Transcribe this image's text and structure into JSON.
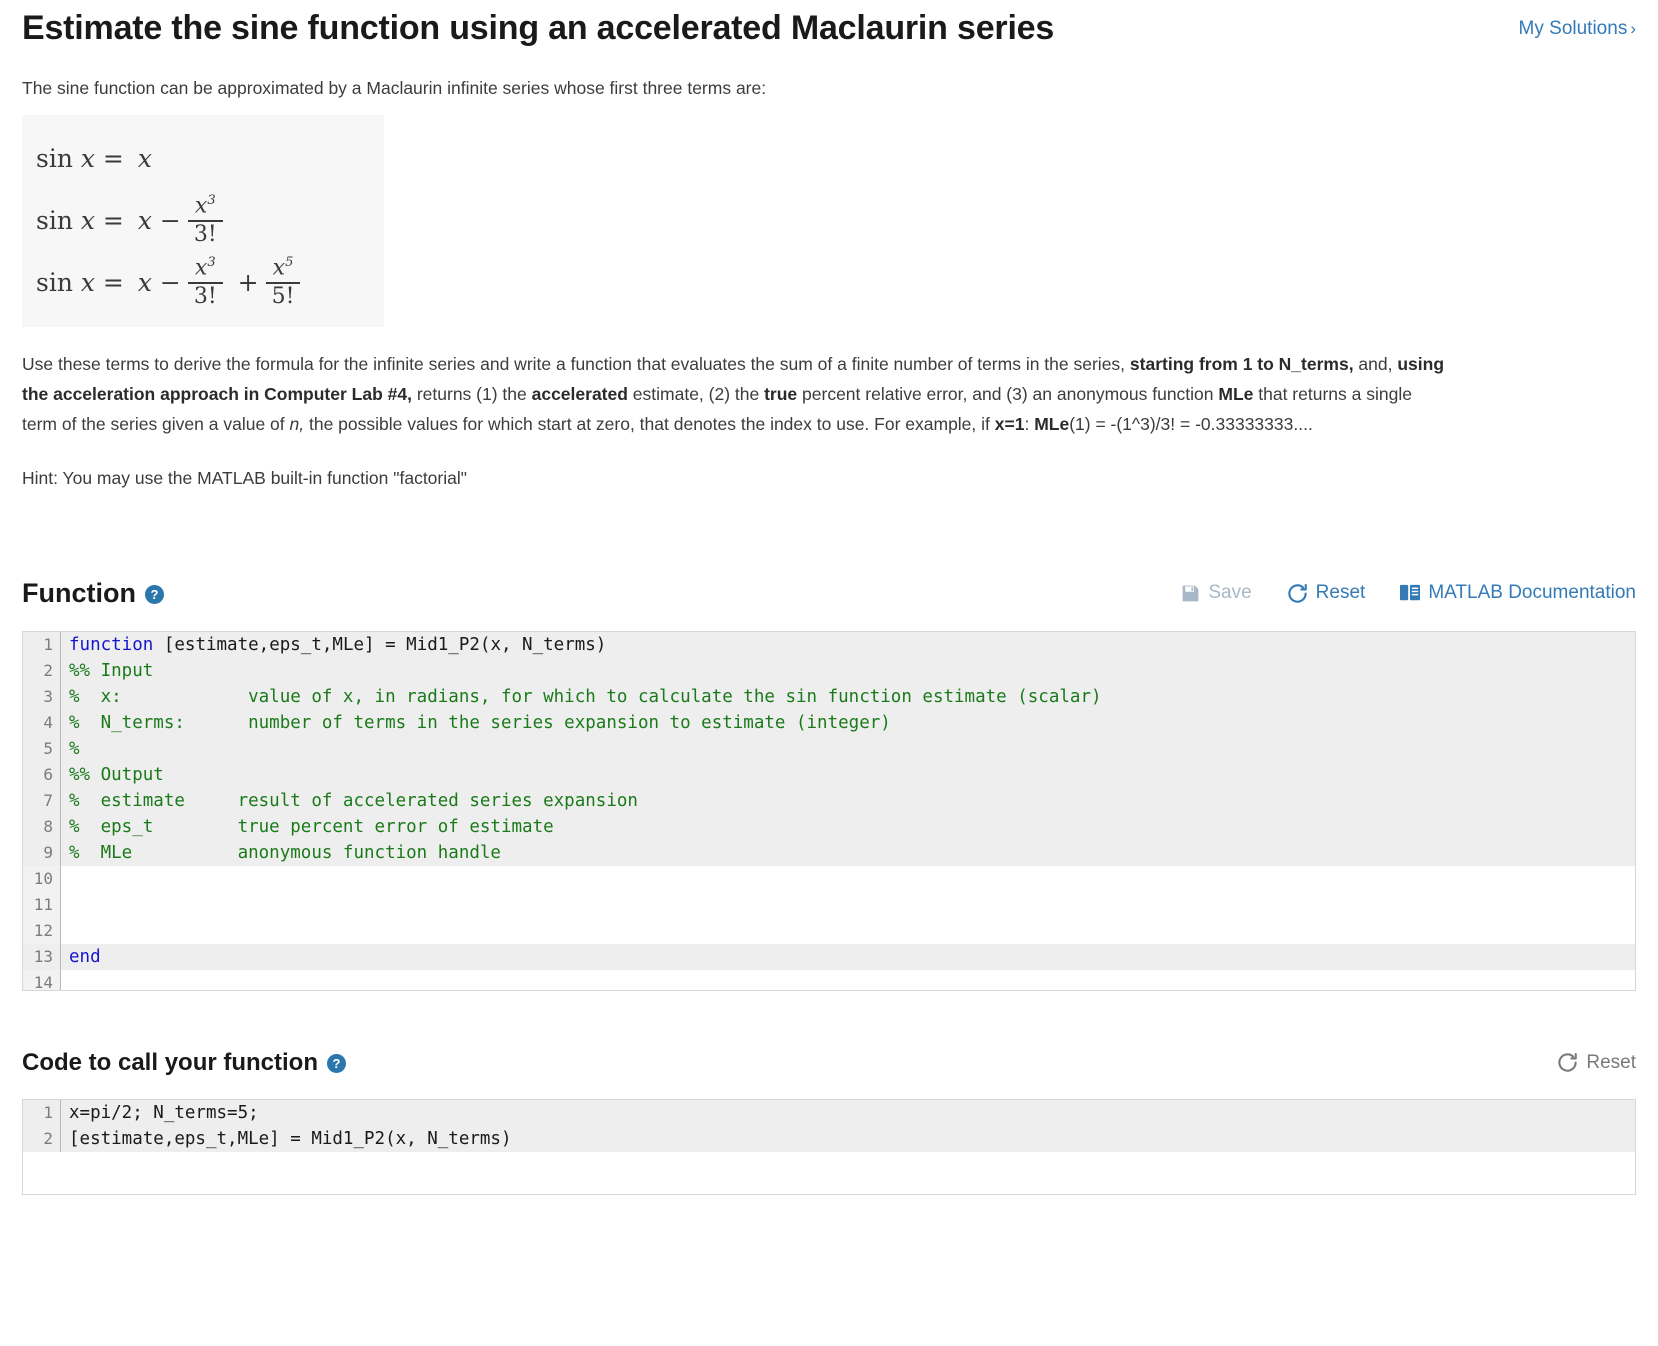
{
  "header": {
    "title": "Estimate the sine function using an accelerated Maclaurin series",
    "my_solutions_label": "My Solutions",
    "my_solutions_chevron": "›",
    "link_color": "#337ab7"
  },
  "description": {
    "intro": "The sine function can be approximated by a Maclaurin infinite series whose first three terms are:",
    "formula_alt": "sin x = x ; sin x = x - x^3/3! ; sin x = x - x^3/3! + x^5/5!",
    "formulas": [
      {
        "lhs": "sin x =",
        "terms": [
          "x"
        ]
      },
      {
        "lhs": "sin x =",
        "terms": [
          "x",
          "-",
          "x^3/3!"
        ]
      },
      {
        "lhs": "sin x =",
        "terms": [
          "x",
          "-",
          "x^3/3!",
          "+",
          "x^5/5!"
        ]
      }
    ],
    "body_parts": [
      {
        "text": "Use these terms to derive the formula for the infinite series and write a function that evaluates the sum of a finite number of terms in the series, ",
        "style": "normal"
      },
      {
        "text": "starting from 1 to N_terms,",
        "style": "bold"
      },
      {
        "text": " and, ",
        "style": "normal"
      },
      {
        "text": "using the acceleration approach in Computer Lab #4,",
        "style": "bold"
      },
      {
        "text": " returns (1) the ",
        "style": "normal"
      },
      {
        "text": "accelerated",
        "style": "bold"
      },
      {
        "text": " estimate, (2) the ",
        "style": "normal"
      },
      {
        "text": "true",
        "style": "bold"
      },
      {
        "text": " percent relative error, and (3) an anonymous function ",
        "style": "normal"
      },
      {
        "text": "MLe",
        "style": "bold"
      },
      {
        "text": " that returns a single term of the series given a value of ",
        "style": "normal"
      },
      {
        "text": "n,",
        "style": "italic"
      },
      {
        "text": " the possible values for which start at zero, that denotes the index to use. For example, if ",
        "style": "normal"
      },
      {
        "text": "x=1",
        "style": "bold"
      },
      {
        "text": ":  ",
        "style": "normal"
      },
      {
        "text": "MLe",
        "style": "bold"
      },
      {
        "text": "(1) = -(1^3)/3! = -0.33333333....",
        "style": "normal"
      }
    ],
    "hint": "Hint: You may use the MATLAB built-in function \"factorial\""
  },
  "function_section": {
    "title": "Function",
    "help_icon": "?",
    "help_glyph": "question-mark",
    "toolbar": [
      {
        "id": "save",
        "label": "Save",
        "icon": "floppy-disk-save-icon",
        "state": "disabled",
        "color": "#a7b9c9"
      },
      {
        "id": "reset",
        "label": "Reset",
        "icon": "refresh-reset-icon",
        "state": "enabled",
        "color": "#337ab7"
      },
      {
        "id": "matlab-documentation",
        "label": "MATLAB Documentation",
        "icon": "book-documentation-icon",
        "state": "enabled",
        "color": "#337ab7"
      }
    ],
    "code_lines": [
      {
        "n": "1",
        "highlight": true,
        "tokens": [
          {
            "t": "function",
            "c": "kw"
          },
          {
            "t": " [estimate,eps_t,MLe] = Mid1_P2(x, N_terms)",
            "c": "plain"
          }
        ]
      },
      {
        "n": "2",
        "highlight": true,
        "tokens": [
          {
            "t": "%% Input",
            "c": "cm"
          }
        ]
      },
      {
        "n": "3",
        "highlight": true,
        "tokens": [
          {
            "t": "%  x:            value of x, in radians, for which to calculate the sin function estimate (scalar)",
            "c": "cm"
          }
        ]
      },
      {
        "n": "4",
        "highlight": true,
        "tokens": [
          {
            "t": "%  N_terms:      number of terms in the series expansion to estimate (integer)",
            "c": "cm"
          }
        ]
      },
      {
        "n": "5",
        "highlight": true,
        "tokens": [
          {
            "t": "%",
            "c": "cm"
          }
        ]
      },
      {
        "n": "6",
        "highlight": true,
        "tokens": [
          {
            "t": "%% Output",
            "c": "cm"
          }
        ]
      },
      {
        "n": "7",
        "highlight": true,
        "tokens": [
          {
            "t": "%  estimate     result of accelerated series expansion",
            "c": "cm"
          }
        ]
      },
      {
        "n": "8",
        "highlight": true,
        "tokens": [
          {
            "t": "%  eps_t        true percent error of estimate",
            "c": "cm"
          }
        ]
      },
      {
        "n": "9",
        "highlight": true,
        "tokens": [
          {
            "t": "%  MLe          anonymous function handle",
            "c": "cm"
          }
        ]
      },
      {
        "n": "10",
        "highlight": false,
        "tokens": [
          {
            "t": "",
            "c": "plain"
          }
        ]
      },
      {
        "n": "11",
        "highlight": false,
        "tokens": [
          {
            "t": "",
            "c": "plain"
          }
        ]
      },
      {
        "n": "12",
        "highlight": false,
        "tokens": [
          {
            "t": "",
            "c": "plain"
          }
        ]
      },
      {
        "n": "13",
        "highlight": true,
        "tokens": [
          {
            "t": "end",
            "c": "kw"
          }
        ]
      },
      {
        "n": "14",
        "highlight": false,
        "tokens": [
          {
            "t": "",
            "c": "plain"
          }
        ]
      }
    ]
  },
  "call_section": {
    "title": "Code to call your function",
    "help_icon": "?",
    "toolbar": [
      {
        "id": "reset-call",
        "label": "Reset",
        "icon": "refresh-reset-icon",
        "state": "muted",
        "color": "#7a7a7a"
      }
    ],
    "code_lines": [
      {
        "n": "1",
        "highlight": true,
        "tokens": [
          {
            "t": "x=pi/2; N_terms=5;",
            "c": "plain"
          }
        ]
      },
      {
        "n": "2",
        "highlight": true,
        "tokens": [
          {
            "t": "[estimate,eps_t,MLe] = Mid1_P2(x, N_terms)",
            "c": "plain"
          }
        ]
      }
    ]
  },
  "colors": {
    "accent_blue": "#337ab7",
    "help_blue": "#2b76ab",
    "keyword_blue": "#1515cf",
    "comment_green": "#1a7a1a",
    "gutter_bg": "#f2f2f2",
    "highlight_bg": "#eeeeee",
    "formula_bg": "#f7f7f7"
  }
}
